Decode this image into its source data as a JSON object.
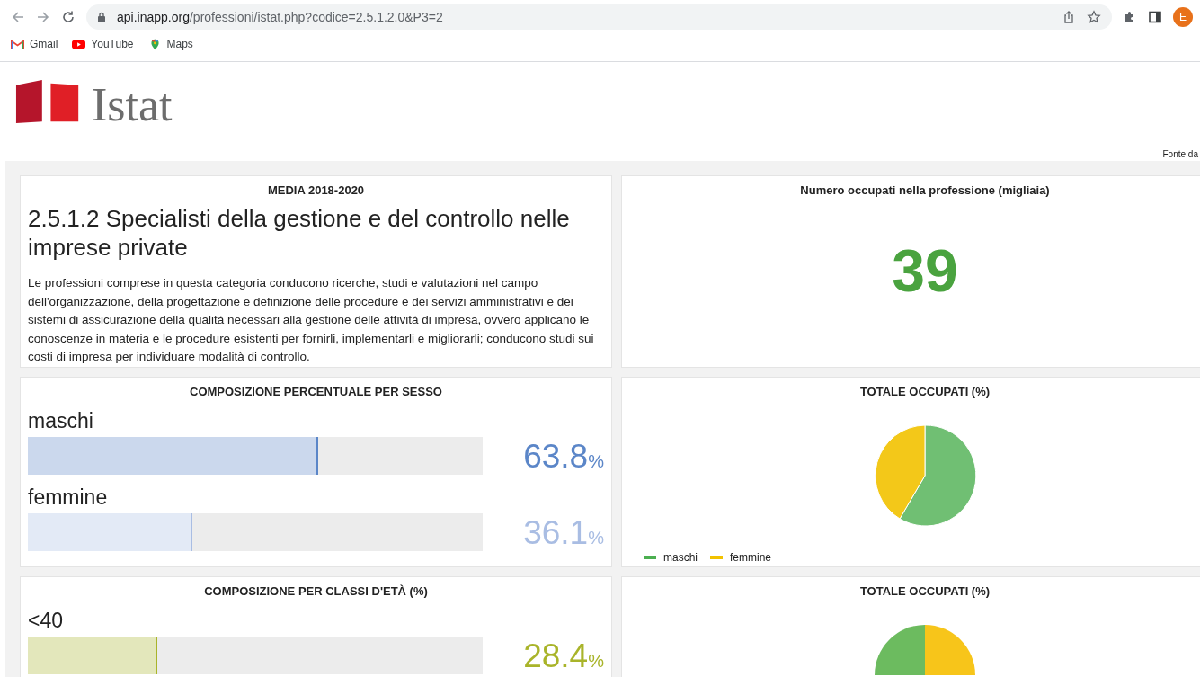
{
  "browser": {
    "url_host": "api.inapp.org",
    "url_path": "/professioni/istat.php?codice=2.5.1.2.0&P3=2",
    "avatar": "E",
    "bookmarks": [
      {
        "label": "Gmail",
        "kind": "gmail"
      },
      {
        "label": "YouTube",
        "kind": "youtube"
      },
      {
        "label": "Maps",
        "kind": "maps"
      }
    ]
  },
  "logo": {
    "text": "Istat"
  },
  "source_note": "Fonte da",
  "intro_card": {
    "heading": "MEDIA 2018-2020",
    "title": "2.5.1.2 Specialisti della gestione e del controllo nelle imprese private",
    "description": "Le professioni comprese in questa categoria conducono ricerche, studi e valutazioni nel campo dell'organizzazione, della progettazione e definizione delle procedure e dei servizi amministrativi e dei sistemi di assicurazione della qualità necessari alla gestione delle attività di impresa, ovvero applicano le conoscenze in materia e le procedure esistenti per fornirli, implementarli e migliorarli; conducono studi sui costi di impresa per individuare modalità di controllo."
  },
  "count_card": {
    "heading": "Numero occupati nella professione (migliaia)",
    "value": "39"
  },
  "sex_card": {
    "heading": "COMPOSIZIONE PERCENTUALE PER SESSO",
    "rows": [
      {
        "label": "maschi",
        "level": 0.638,
        "value": "63.8",
        "unit": "%",
        "color": "#5b86c8"
      },
      {
        "label": "femmine",
        "level": 0.361,
        "value": "36.1",
        "unit": "%",
        "color": "#a9bde3"
      }
    ]
  },
  "sex_pie_card": {
    "heading": "TOTALE OCCUPATI (%)",
    "legend": [
      {
        "label": "maschi",
        "color": "#4caf50"
      },
      {
        "label": "femmine",
        "color": "#f2c200"
      }
    ]
  },
  "age_card": {
    "heading": "COMPOSIZIONE PER CLASSI D'ETÀ (%)",
    "rows": [
      {
        "label": "<40",
        "level": 0.284,
        "value": "28.4",
        "unit": "%",
        "color": "#a9b42a"
      }
    ]
  },
  "age_pie_card": {
    "heading": "TOTALE OCCUPATI (%)"
  }
}
